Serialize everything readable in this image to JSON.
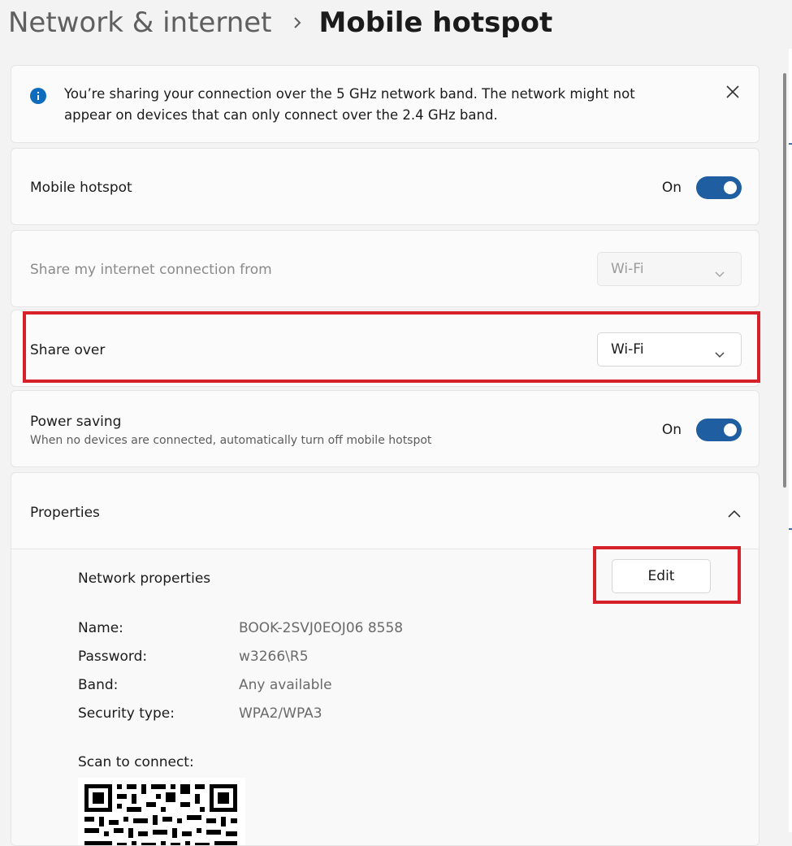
{
  "breadcrumb": {
    "parent": "Network & internet",
    "current": "Mobile hotspot"
  },
  "info_banner": {
    "text": "You’re sharing your connection over the 5 GHz network band. The network might not appear on devices that can only connect over the 2.4 GHz band."
  },
  "mobile_hotspot": {
    "label": "Mobile hotspot",
    "state": "On"
  },
  "share_from": {
    "label": "Share my internet connection from",
    "value": "Wi-Fi"
  },
  "share_over": {
    "label": "Share over",
    "value": "Wi-Fi"
  },
  "power_saving": {
    "label": "Power saving",
    "description": "When no devices are connected, automatically turn off mobile hotspot",
    "state": "On"
  },
  "properties": {
    "label": "Properties",
    "network_properties_label": "Network properties",
    "edit_label": "Edit",
    "rows": [
      {
        "key": "Name:",
        "value": "BOOK-2SVJ0EOJ06 8558"
      },
      {
        "key": "Password:",
        "value": "w3266\\R5"
      },
      {
        "key": "Band:",
        "value": "Any available"
      },
      {
        "key": "Security type:",
        "value": "WPA2/WPA3"
      }
    ],
    "scan_label": "Scan to connect:"
  },
  "colors": {
    "accent": "#1f5ea0",
    "highlight": "#d6202a",
    "info": "#0f6cbd"
  }
}
